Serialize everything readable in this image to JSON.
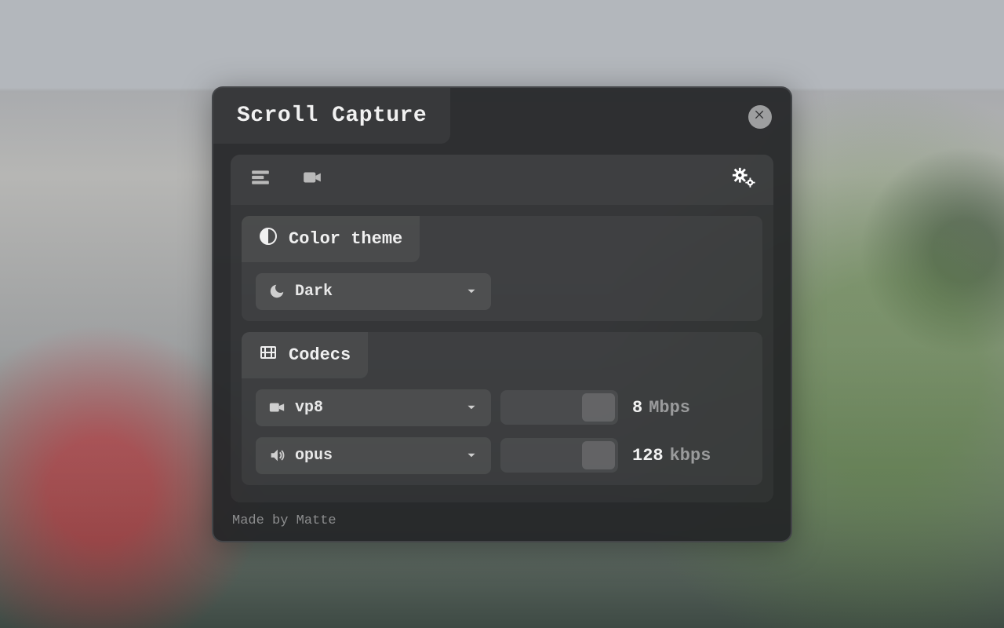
{
  "title": "Scroll Capture",
  "sections": {
    "color_theme": {
      "header": "Color theme",
      "selected_label": "Dark"
    },
    "codecs": {
      "header": "Codecs",
      "video": {
        "selected_label": "vp8",
        "bitrate_value": "8",
        "bitrate_unit": "Mbps"
      },
      "audio": {
        "selected_label": "opus",
        "bitrate_value": "128",
        "bitrate_unit": "kbps"
      }
    }
  },
  "footer": "Made by Matte"
}
